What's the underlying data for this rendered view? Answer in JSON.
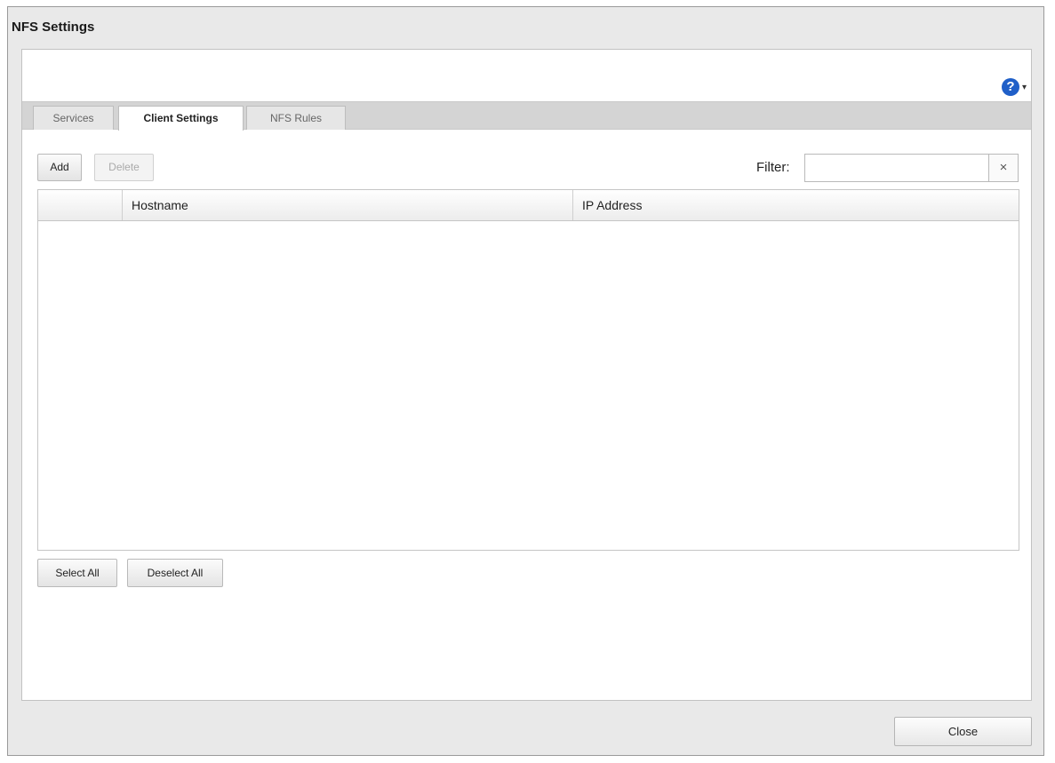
{
  "dialog": {
    "title": "NFS Settings"
  },
  "help": {
    "icon": "question-circle-icon",
    "glyph": "?",
    "caret": "▾"
  },
  "tabs": [
    {
      "label": "Services",
      "active": false
    },
    {
      "label": "Client Settings",
      "active": true
    },
    {
      "label": "NFS Rules",
      "active": false
    }
  ],
  "toolbar": {
    "add_label": "Add",
    "delete_label": "Delete"
  },
  "filter": {
    "label": "Filter:",
    "value": "",
    "clear_glyph": "×"
  },
  "table": {
    "columns": [
      "",
      "Hostname",
      "IP Address"
    ],
    "rows": []
  },
  "selection": {
    "select_all_label": "Select All",
    "deselect_all_label": "Deselect All"
  },
  "footer": {
    "close_label": "Close"
  },
  "colors": {
    "help_icon": "#1f5fc8",
    "dialog_bg": "#e9e9e9",
    "tabbar_bg": "#d4d4d4"
  }
}
